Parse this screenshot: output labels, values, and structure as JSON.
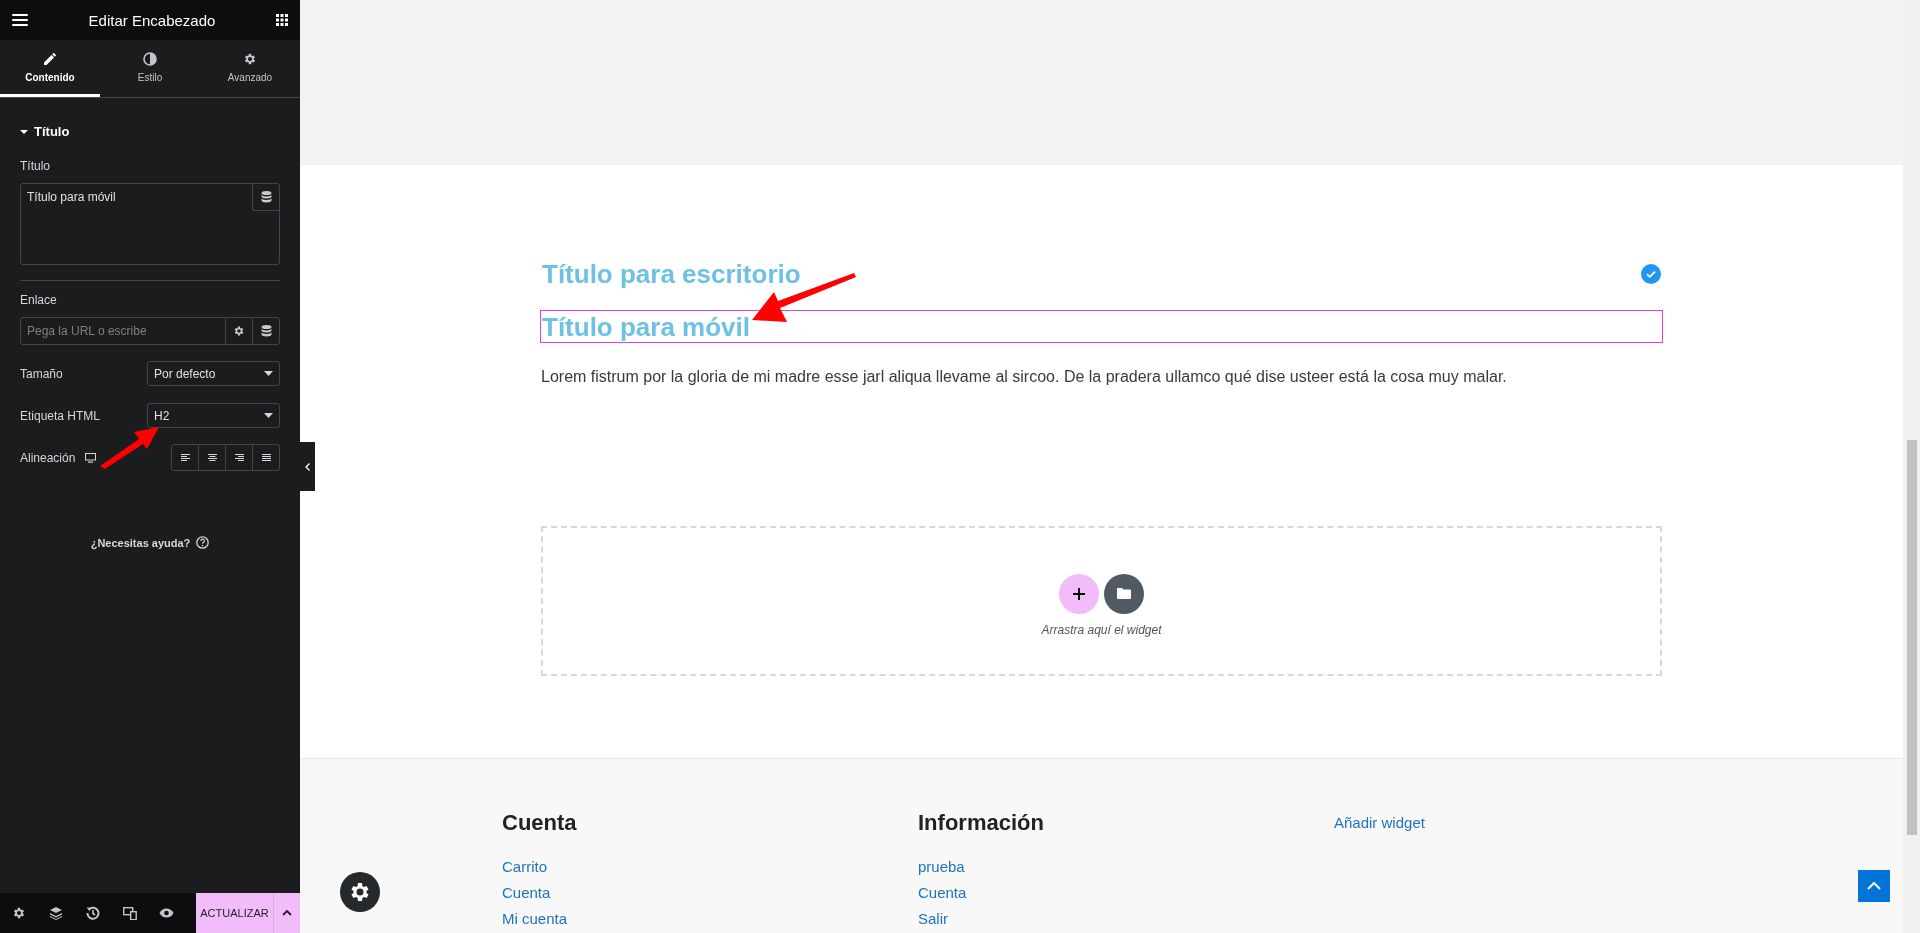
{
  "panel": {
    "title": "Editar Encabezado",
    "tabs": [
      {
        "label": "Contenido",
        "selected": true,
        "kind": "pencil"
      },
      {
        "label": "Estilo",
        "selected": false,
        "kind": "contrast"
      },
      {
        "label": "Avanzado",
        "selected": false,
        "kind": "gear"
      }
    ],
    "section": {
      "title": "Título",
      "expanded": true
    },
    "title_field": {
      "label": "Título",
      "value": "Título para móvil"
    },
    "link_field": {
      "label": "Enlace",
      "placeholder": "Pega la URL o escribe"
    },
    "size_select": {
      "label": "Tamaño",
      "value": "Por defecto"
    },
    "tag_select": {
      "label": "Etiqueta HTML",
      "value": "H2"
    },
    "alignment": {
      "label": "Alineación",
      "options": [
        {
          "kind": "left",
          "selected": false
        },
        {
          "kind": "center",
          "selected": false
        },
        {
          "kind": "right",
          "selected": false
        },
        {
          "kind": "justify",
          "selected": false
        }
      ]
    },
    "help": "¿Necesitas ayuda?"
  },
  "bottom_bar": {
    "update_button": "ACTUALIZAR"
  },
  "canvas": {
    "headings": [
      {
        "text": "Título para escritorio",
        "selected": false,
        "visible_check": true
      },
      {
        "text": "Título para móvil",
        "selected": true,
        "visible_check": false
      }
    ],
    "paragraph": "Lorem fistrum por la gloria de mi madre esse jarl aliqua llevame al sircoo. De la pradera ullamco qué dise usteer está la cosa muy malar.",
    "dropzone": {
      "hint": "Arrastra aquí el widget"
    }
  },
  "footer": {
    "columns": [
      {
        "heading": "Cuenta",
        "links": [
          "Carrito",
          "Cuenta",
          "Mi cuenta"
        ]
      },
      {
        "heading": "Información",
        "links": [
          "prueba",
          "Cuenta",
          "Salir"
        ]
      },
      {
        "links": [
          "Añadir widget"
        ]
      }
    ]
  }
}
